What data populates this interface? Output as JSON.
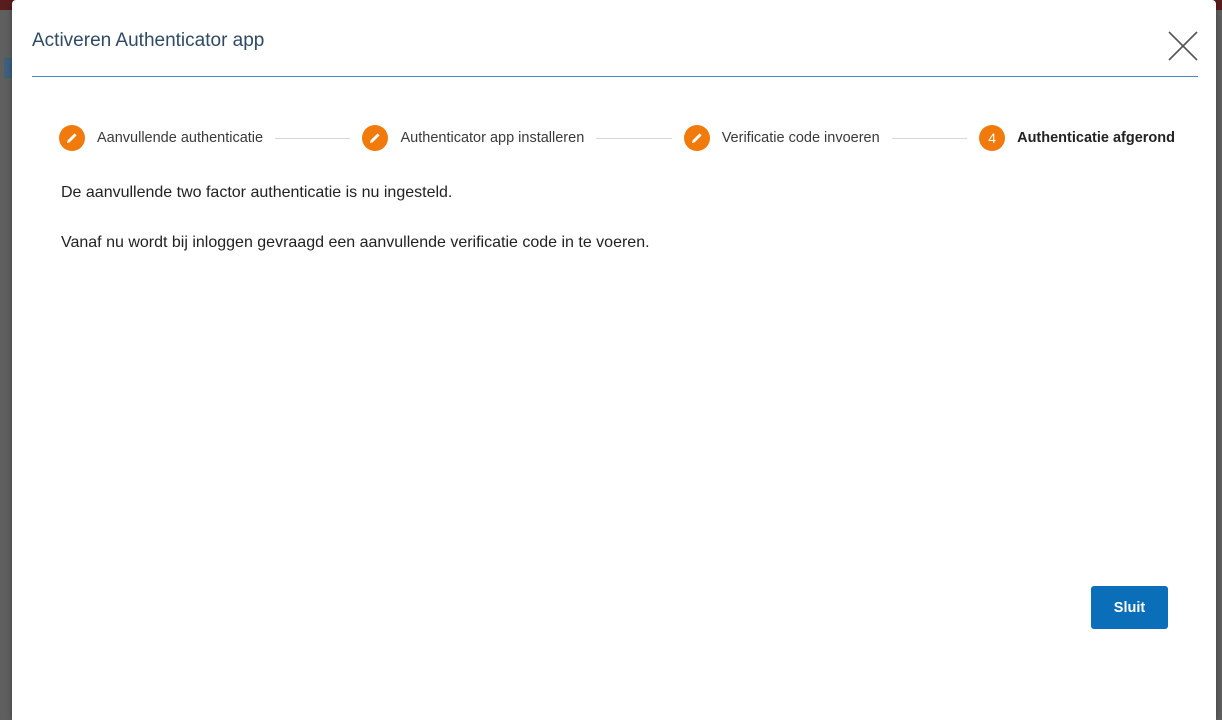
{
  "dialog": {
    "title": "Activeren Authenticator app",
    "close_icon": "close-x-icon"
  },
  "stepper": {
    "accent_color": "#f07a0c",
    "steps": [
      {
        "label": "Aanvullende authenticatie",
        "state": "completed",
        "icon": "pencil-icon"
      },
      {
        "label": "Authenticator app installeren",
        "state": "completed",
        "icon": "pencil-icon"
      },
      {
        "label": "Verificatie code invoeren",
        "state": "completed",
        "icon": "pencil-icon"
      },
      {
        "label": "Authenticatie afgerond",
        "state": "active",
        "number": "4"
      }
    ]
  },
  "content": {
    "line1": "De aanvullende two factor authenticatie is nu ingesteld.",
    "line2": "Vanaf nu wordt bij inloggen gevraagd een aanvullende verificatie code in te voeren."
  },
  "footer": {
    "close_label": "Sluit",
    "button_color": "#0a6eb9"
  }
}
